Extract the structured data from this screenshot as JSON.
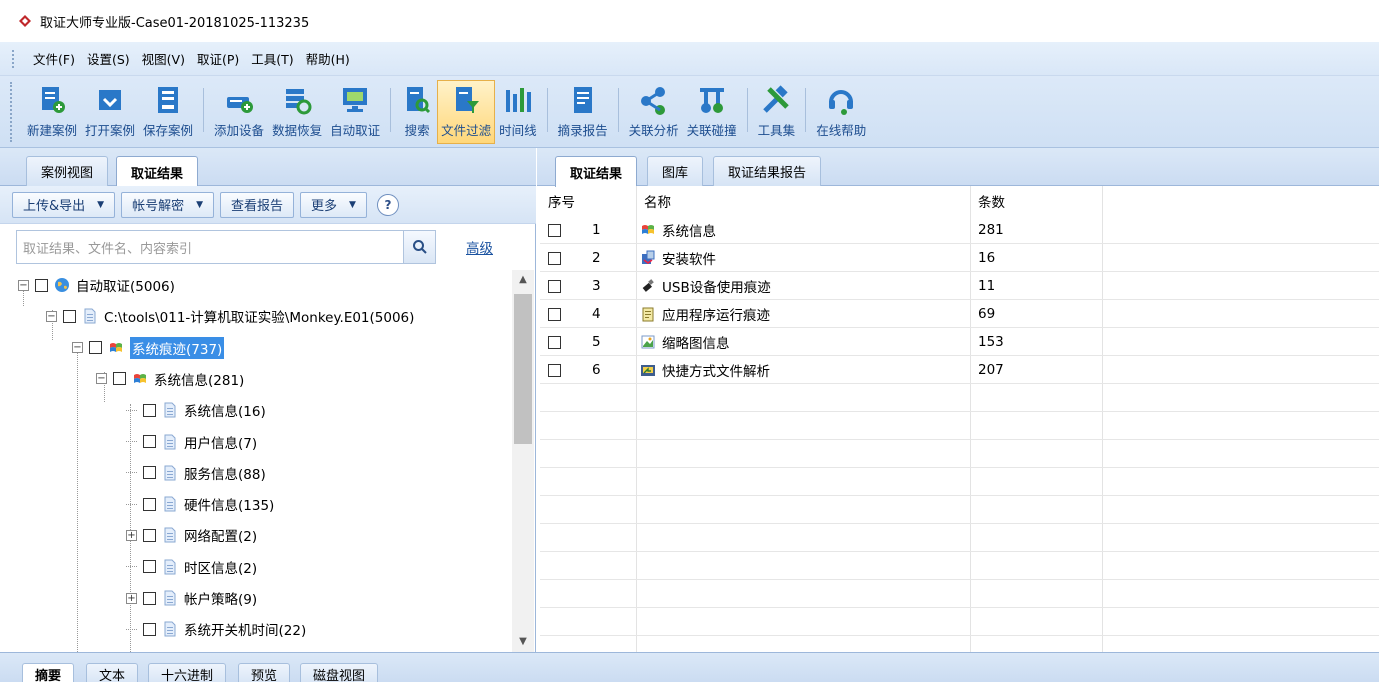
{
  "window": {
    "title": "取证大师专业版-Case01-20181025-113235"
  },
  "menu": [
    "文件(F)",
    "设置(S)",
    "视图(V)",
    "取证(P)",
    "工具(T)",
    "帮助(H)"
  ],
  "toolbar": [
    {
      "label": "新建案例",
      "icon": "new-case-icon"
    },
    {
      "label": "打开案例",
      "icon": "open-case-icon"
    },
    {
      "label": "保存案例",
      "icon": "save-case-icon"
    },
    {
      "label": "添加设备",
      "icon": "add-device-icon"
    },
    {
      "label": "数据恢复",
      "icon": "data-recovery-icon"
    },
    {
      "label": "自动取证",
      "icon": "auto-forensics-icon"
    },
    {
      "label": "搜索",
      "icon": "search-doc-icon"
    },
    {
      "label": "文件过滤",
      "icon": "file-filter-icon",
      "active": true
    },
    {
      "label": "时间线",
      "icon": "timeline-icon"
    },
    {
      "label": "摘录报告",
      "icon": "excerpt-report-icon"
    },
    {
      "label": "关联分析",
      "icon": "association-analysis-icon"
    },
    {
      "label": "关联碰撞",
      "icon": "association-collision-icon"
    },
    {
      "label": "工具集",
      "icon": "toolkit-icon"
    },
    {
      "label": "在线帮助",
      "icon": "online-help-icon"
    }
  ],
  "left": {
    "tabs": [
      "案例视图",
      "取证结果"
    ],
    "selected_tab": "取证结果",
    "actions": {
      "upload": "上传&导出",
      "decrypt": "帐号解密",
      "report": "查看报告",
      "more": "更多",
      "help": "?"
    },
    "search": {
      "placeholder": "取证结果、文件名、内容索引",
      "advanced": "高级"
    },
    "tree": [
      {
        "label": "自动取证(5006)",
        "level": 0,
        "expander": "minus",
        "icon": "globe-icon"
      },
      {
        "label": "C:\\tools\\011-计算机取证实验\\Monkey.E01(5006)",
        "level": 1,
        "expander": "minus",
        "icon": "document-icon"
      },
      {
        "label": "系统痕迹(737)",
        "level": 2,
        "expander": "minus",
        "icon": "windows-logo-icon",
        "selected": true
      },
      {
        "label": "系统信息(281)",
        "level": 3,
        "expander": "minus",
        "icon": "windows-logo-icon"
      },
      {
        "label": "系统信息(16)",
        "level": 4,
        "expander": "none",
        "icon": "document-icon"
      },
      {
        "label": "用户信息(7)",
        "level": 4,
        "expander": "none",
        "icon": "document-icon"
      },
      {
        "label": "服务信息(88)",
        "level": 4,
        "expander": "none",
        "icon": "document-icon"
      },
      {
        "label": "硬件信息(135)",
        "level": 4,
        "expander": "none",
        "icon": "document-icon"
      },
      {
        "label": "网络配置(2)",
        "level": 4,
        "expander": "plus",
        "icon": "document-icon"
      },
      {
        "label": "时区信息(2)",
        "level": 4,
        "expander": "none",
        "icon": "document-icon"
      },
      {
        "label": "帐户策略(9)",
        "level": 4,
        "expander": "plus",
        "icon": "document-icon"
      },
      {
        "label": "系统开关机时间(22)",
        "level": 4,
        "expander": "none",
        "icon": "document-icon"
      }
    ]
  },
  "right": {
    "tabs": [
      "取证结果",
      "图库",
      "取证结果报告"
    ],
    "selected_tab": "取证结果",
    "columns": [
      "序号",
      "名称",
      "条数"
    ],
    "rows": [
      {
        "no": "1",
        "name": "系统信息",
        "count": "281",
        "icon": "windows-logo-icon"
      },
      {
        "no": "2",
        "name": "安装软件",
        "count": "16",
        "icon": "installer-icon"
      },
      {
        "no": "3",
        "name": "USB设备使用痕迹",
        "count": "11",
        "icon": "usb-icon"
      },
      {
        "no": "4",
        "name": "应用程序运行痕迹",
        "count": "69",
        "icon": "notepad-icon"
      },
      {
        "no": "5",
        "name": "缩略图信息",
        "count": "153",
        "icon": "image-icon"
      },
      {
        "no": "6",
        "name": "快捷方式文件解析",
        "count": "207",
        "icon": "shortcut-icon"
      }
    ]
  },
  "bottom_tabs": [
    "摘要",
    "文本",
    "十六进制",
    "预览",
    "磁盘视图"
  ],
  "colors": {
    "accent": "#3a8ee6",
    "toolbar_text": "#1d4d8f",
    "active_toolbar": "#ffd77a"
  }
}
